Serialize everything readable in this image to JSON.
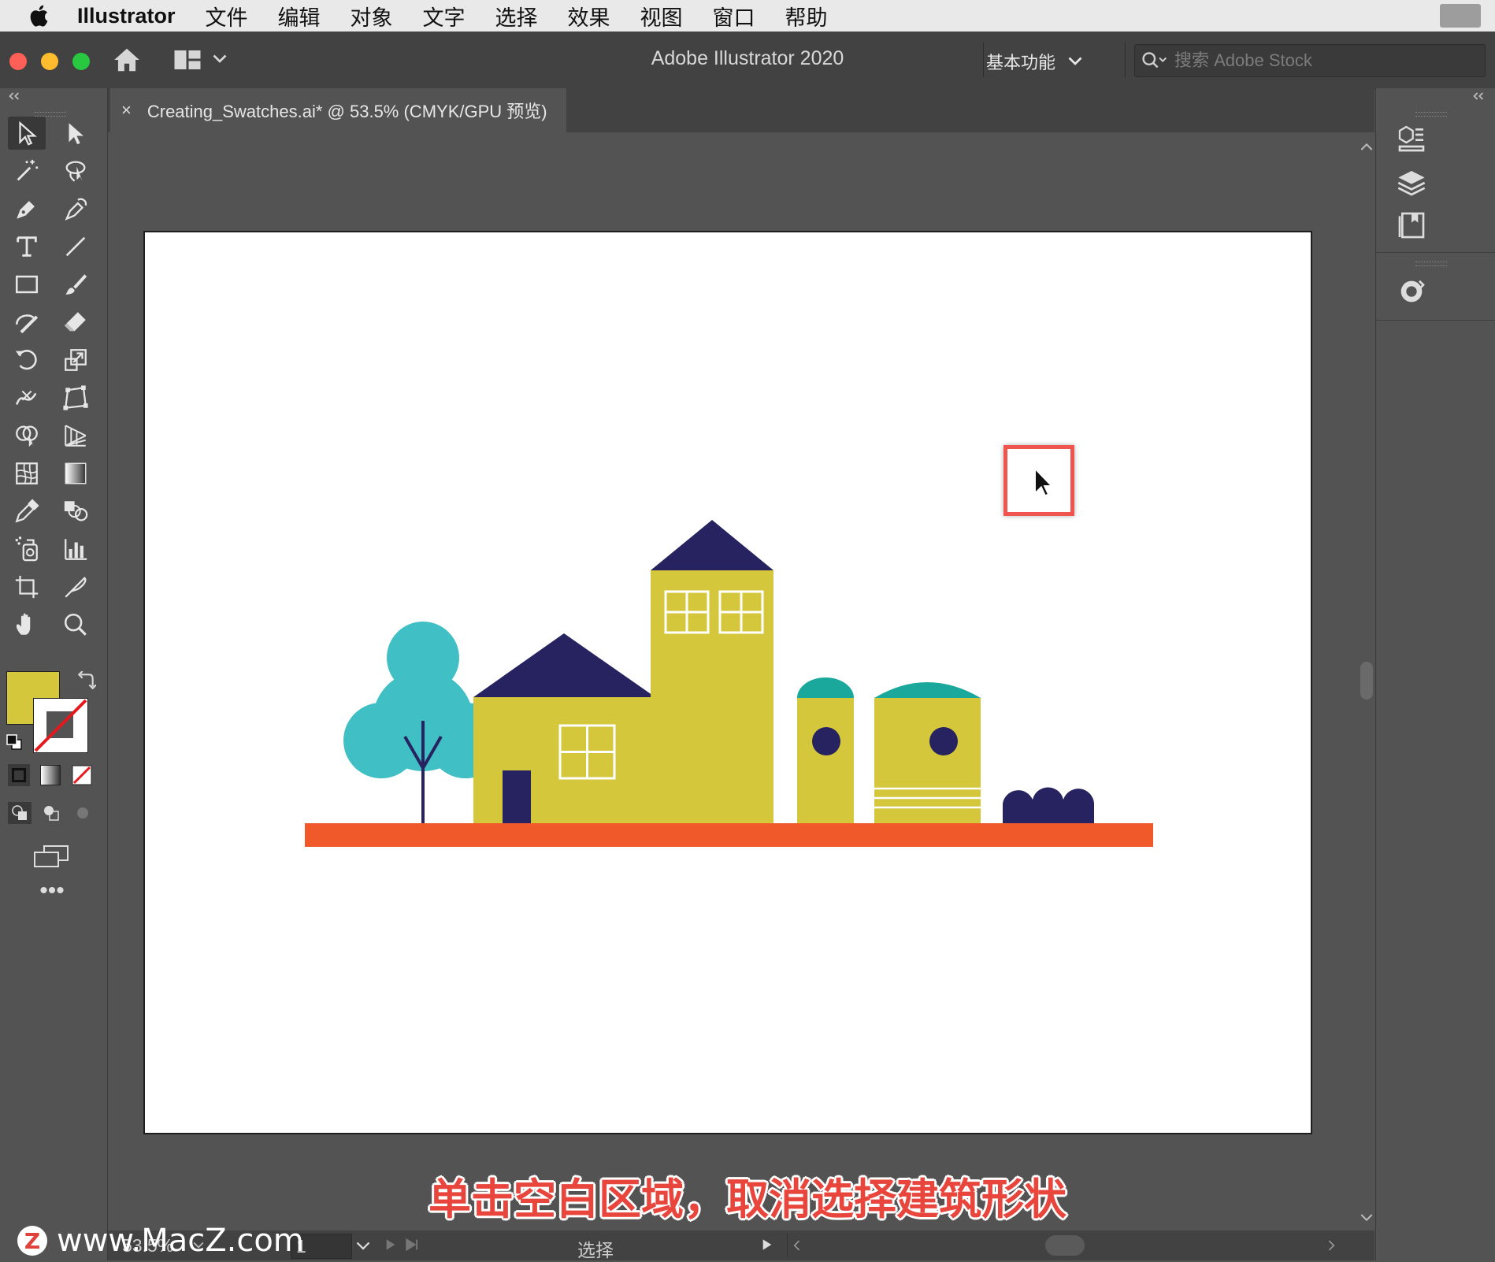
{
  "menubar": {
    "app_name": "Illustrator",
    "items": [
      "文件",
      "编辑",
      "对象",
      "文字",
      "选择",
      "效果",
      "视图",
      "窗口",
      "帮助"
    ]
  },
  "titlebar": {
    "title": "Adobe Illustrator 2020",
    "workspace": "基本功能",
    "stock_placeholder": "搜索 Adobe Stock"
  },
  "document_tab": {
    "label": "Creating_Swatches.ai* @ 53.5% (CMYK/GPU 预览)",
    "close_symbol": "×"
  },
  "colors": {
    "fill": "#d4c73b",
    "stroke": "none",
    "ground": "#f05a2a",
    "roof": "#272361",
    "building": "#d4c73b",
    "tree": "#40bfc5",
    "dome": "#1aa89c",
    "highlight_box": "#f0544e"
  },
  "statusbar": {
    "zoom": "53.5%",
    "artboard_number": "1",
    "tool_status": "选择"
  },
  "caption": "单击空白区域，取消选择建筑形状",
  "watermark": "www.MacZ.com",
  "watermark_logo": "Z"
}
